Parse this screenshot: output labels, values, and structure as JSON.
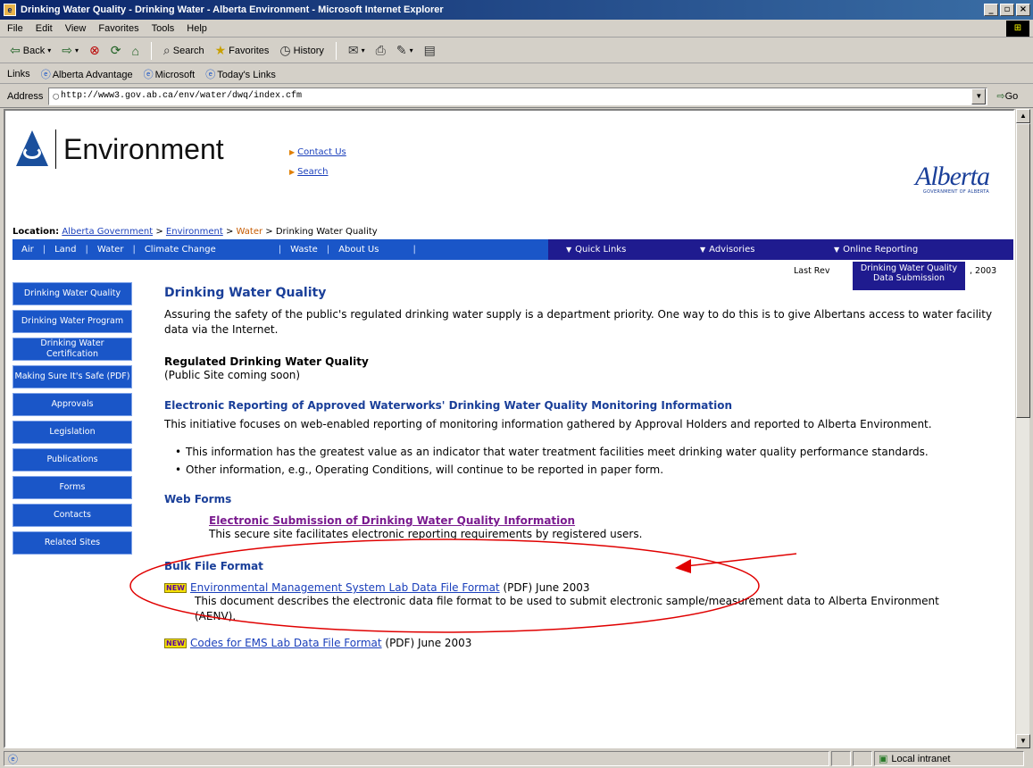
{
  "window": {
    "title": "Drinking Water Quality - Drinking Water - Alberta Environment - Microsoft Internet Explorer",
    "min": "_",
    "max": "▫",
    "close": "×"
  },
  "menu": [
    "File",
    "Edit",
    "View",
    "Favorites",
    "Tools",
    "Help"
  ],
  "toolbar": {
    "back": "Back",
    "search": "Search",
    "favorites": "Favorites",
    "history": "History"
  },
  "links_bar": {
    "label": "Links",
    "items": [
      "Alberta Advantage",
      "Microsoft",
      "Today's Links"
    ]
  },
  "address": {
    "label": "Address",
    "url": "http://www3.gov.ab.ca/env/water/dwq/index.cfm",
    "go": "Go"
  },
  "status": {
    "zone": "Local intranet"
  },
  "site": {
    "brand": "Environment",
    "top_links": [
      "Contact Us",
      "Search"
    ],
    "alberta_word": "Alberta",
    "alberta_sub": "GOVERNMENT OF ALBERTA"
  },
  "location": {
    "label": "Location:",
    "crumbs": [
      "Alberta Government",
      "Environment",
      "Water",
      "Drinking Water Quality"
    ],
    "sep": ">"
  },
  "nav": {
    "items": [
      "Air",
      "Land",
      "Water",
      "Climate Change",
      "Waste",
      "About Us"
    ],
    "dropdowns": [
      "Quick Links",
      "Advisories",
      "Online Reporting"
    ],
    "online_menu_item": "Drinking Water Quality Data Submission"
  },
  "last_revised": {
    "prefix": "Last Rev",
    "suffix": ", 2003"
  },
  "sidebar": [
    "Drinking Water Quality",
    "Drinking Water Program",
    "Drinking Water Certification",
    "Making Sure It's Safe (PDF)",
    "Approvals",
    "Legislation",
    "Publications",
    "Forms",
    "Contacts",
    "Related Sites"
  ],
  "content": {
    "title": "Drinking Water Quality",
    "intro": "Assuring the safety of the public's regulated drinking water supply is a department priority.  One way to do this is to give Albertans access to water facility data via the Internet.",
    "regulated_heading": "Regulated Drinking Water Quality",
    "regulated_note": "(Public Site coming soon)",
    "electronic_heading": "Electronic Reporting of Approved Waterworks' Drinking Water Quality Monitoring Information",
    "electronic_text": "This initiative focuses on web-enabled reporting of monitoring information gathered by Approval Holders and reported to Alberta Environment.",
    "bullets": [
      "This information has the greatest value as an indicator that water treatment facilities meet drinking water quality performance standards.",
      "Other information, e.g., Operating Conditions, will continue to be reported in paper form."
    ],
    "web_forms_heading": "Web Forms",
    "web_forms_link": "Electronic Submission of Drinking Water Quality Information",
    "web_forms_desc": "This secure site facilitates electronic reporting requirements by registered users.",
    "bulk_heading": "Bulk File Format",
    "new_badge": "NEW",
    "bulk1_link": "Environmental Management System Lab Data File Format",
    "bulk1_suffix": " (PDF) June 2003",
    "bulk1_desc": "This document describes the electronic data file format to be used to submit electronic sample/measurement data to Alberta Environment (AENV).",
    "bulk2_link": "Codes for EMS Lab Data File Format",
    "bulk2_suffix": " (PDF) June 2003"
  },
  "colors": {
    "nav_blue": "#1a56c8",
    "nav_dark": "#1f1b8f",
    "heading_blue": "#1a3f99",
    "annotation_red": "#e00000"
  }
}
